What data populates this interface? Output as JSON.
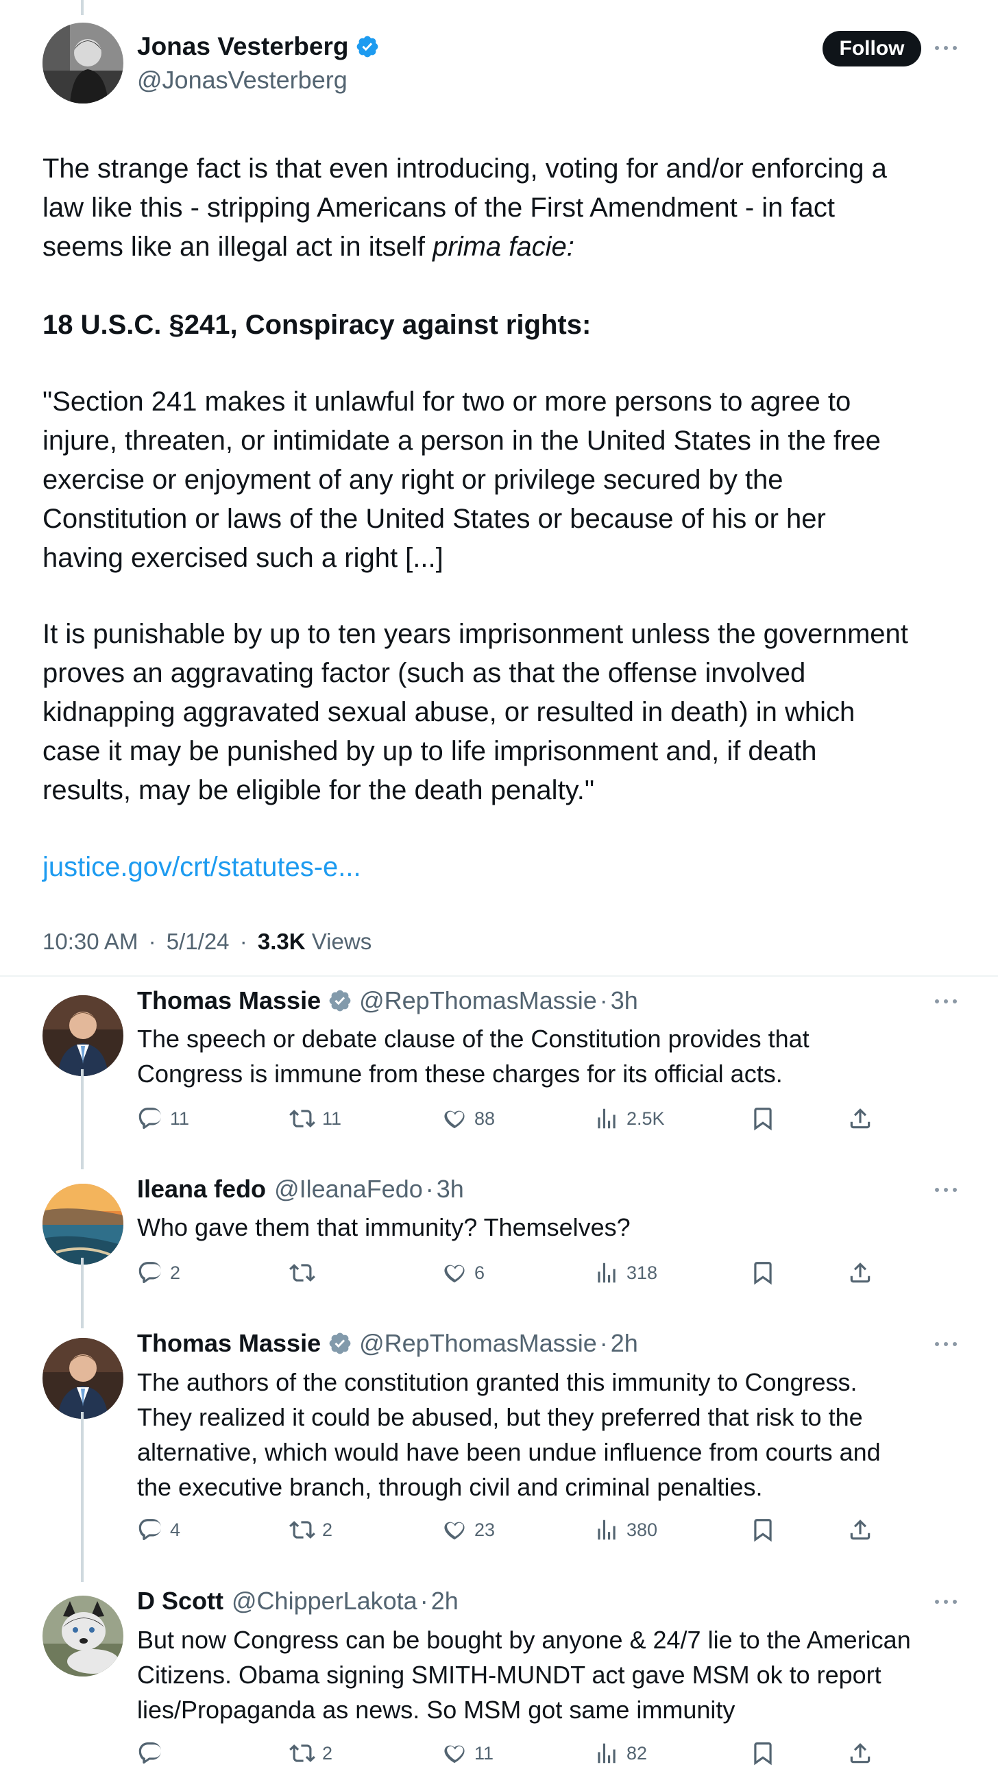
{
  "main_tweet": {
    "author_name": "Jonas Vesterberg",
    "author_handle": "@JonasVesterberg",
    "follow_label": "Follow",
    "paragraph1_lines": [
      "The strange fact is that even introducing, voting for and/or enforcing a",
      "law like this - stripping Americans of the First Amendment - in fact"
    ],
    "paragraph1_last_plain": "seems like an illegal act in itself ",
    "paragraph1_last_italic": "prima facie:",
    "heading": "18 U.S.C. §241, Conspiracy against rights:",
    "quote1_lines": [
      "\"Section 241 makes it unlawful for two or more persons to agree to",
      "injure, threaten, or intimidate a person in the United States in the free",
      "exercise or enjoyment of any right or privilege secured by the",
      "Constitution or laws of the United States or because of his or her",
      "having exercised such a right [...]"
    ],
    "quote2_lines": [
      "It is punishable by up to ten years imprisonment unless the government",
      "proves an aggravating factor (such as that the offense involved",
      "kidnapping aggravated sexual abuse, or resulted in death) in which",
      "case  it may be punished by up to life imprisonment and, if death",
      "results, may  be eligible for the death penalty.\""
    ],
    "link": "justice.gov/crt/statutes-e...",
    "time": "10:30 AM",
    "date": "5/1/24",
    "views_count": "3.3K",
    "views_label": "Views",
    "separator": "·"
  },
  "replies": [
    {
      "name": "Thomas Massie",
      "verified": true,
      "handle": "@RepThomasMassie",
      "time": "3h",
      "lines": [
        "The speech or debate clause of the Constitution provides that",
        "Congress is immune from these charges for its official acts."
      ],
      "replies": "11",
      "reposts": "11",
      "likes": "88",
      "views": "2.5K"
    },
    {
      "name": "Ileana fedo",
      "verified": false,
      "handle": "@IleanaFedo",
      "time": "3h",
      "lines": [
        "Who gave them that immunity?  Themselves?"
      ],
      "replies": "2",
      "reposts": "",
      "likes": "6",
      "views": "318"
    },
    {
      "name": "Thomas Massie",
      "verified": true,
      "handle": "@RepThomasMassie",
      "time": "2h",
      "lines": [
        "The authors of the constitution granted this immunity to Congress.",
        "They realized it could be abused, but they preferred that risk to the",
        "alternative, which would have been undue influence from courts and",
        "the executive branch, through civil and criminal penalties."
      ],
      "replies": "4",
      "reposts": "2",
      "likes": "23",
      "views": "380"
    },
    {
      "name": "D Scott",
      "verified": false,
      "handle": "@ChipperLakota",
      "time": "2h",
      "lines": [
        "But now Congress can be bought by anyone & 24/7 lie to the American",
        "Citizens.  Obama signing SMITH-MUNDT act gave MSM ok to report",
        "lies/Propaganda as news.  So MSM got same immunity"
      ],
      "replies": "",
      "reposts": "2",
      "likes": "11",
      "views": "82"
    }
  ],
  "colors": {
    "text": "#0f1419",
    "secondary": "#536471",
    "link": "#1d9bf0",
    "verified_blue": "#1d9bf0",
    "verified_gray": "#829aab",
    "thread_line": "#cfd9de"
  },
  "icons": [
    "verified-badge-icon",
    "more-icon",
    "reply-icon",
    "repost-icon",
    "like-icon",
    "views-icon",
    "bookmark-icon",
    "share-icon"
  ]
}
